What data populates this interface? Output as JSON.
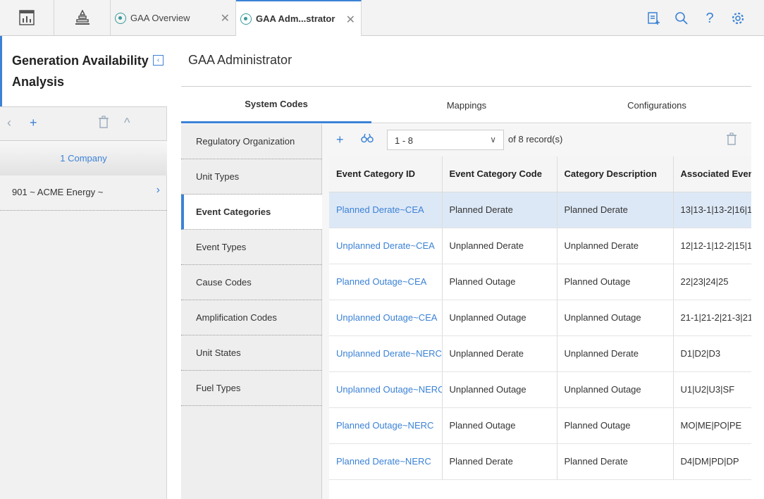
{
  "topbar": {
    "tabs": [
      {
        "label": "GAA Overview",
        "active": false
      },
      {
        "label": "GAA Adm...strator",
        "active": true
      }
    ]
  },
  "left_panel": {
    "title": "Generation Availability Analysis",
    "company_header": "1 Company",
    "items": [
      {
        "label": "901 ~ ACME Energy ~"
      }
    ]
  },
  "main": {
    "title": "GAA Administrator",
    "tabs": [
      {
        "label": "System Codes",
        "active": true
      },
      {
        "label": "Mappings",
        "active": false
      },
      {
        "label": "Configurations",
        "active": false
      }
    ],
    "subnav": [
      {
        "label": "Regulatory Organization"
      },
      {
        "label": "Unit Types"
      },
      {
        "label": "Event Categories",
        "active": true
      },
      {
        "label": "Event Types"
      },
      {
        "label": "Cause Codes"
      },
      {
        "label": "Amplification Codes"
      },
      {
        "label": "Unit States"
      },
      {
        "label": "Fuel Types"
      }
    ],
    "pager": {
      "range": "1 - 8",
      "of_label": "of",
      "total": "8",
      "records_label": "record(s)"
    },
    "table": {
      "columns": [
        "Event Category ID",
        "Event Category Code",
        "Category Description",
        "Associated Event"
      ],
      "rows": [
        {
          "id": "Planned Derate~CEA",
          "code": "Planned Derate",
          "desc": "Planned Derate",
          "assoc": "13|13-1|13-2|16|1"
        },
        {
          "id": "Unplanned Derate~CEA",
          "code": "Unplanned Derate",
          "desc": "Unplanned Derate",
          "assoc": "12|12-1|12-2|15|1"
        },
        {
          "id": "Planned Outage~CEA",
          "code": "Planned Outage",
          "desc": "Planned Outage",
          "assoc": "22|23|24|25"
        },
        {
          "id": "Unplanned Outage~CEA",
          "code": "Unplanned Outage",
          "desc": "Unplanned Outage",
          "assoc": "21-1|21-2|21-3|21"
        },
        {
          "id": "Unplanned Derate~NERC",
          "code": "Unplanned Derate",
          "desc": "Unplanned Derate",
          "assoc": "D1|D2|D3"
        },
        {
          "id": "Unplanned Outage~NERC",
          "code": "Unplanned Outage",
          "desc": "Unplanned Outage",
          "assoc": "U1|U2|U3|SF"
        },
        {
          "id": "Planned Outage~NERC",
          "code": "Planned Outage",
          "desc": "Planned Outage",
          "assoc": "MO|ME|PO|PE"
        },
        {
          "id": "Planned Derate~NERC",
          "code": "Planned Derate",
          "desc": "Planned Derate",
          "assoc": "D4|DM|PD|DP"
        }
      ]
    }
  },
  "colors": {
    "accent": "#3b82d6",
    "selected_row": "#dde8f6"
  }
}
